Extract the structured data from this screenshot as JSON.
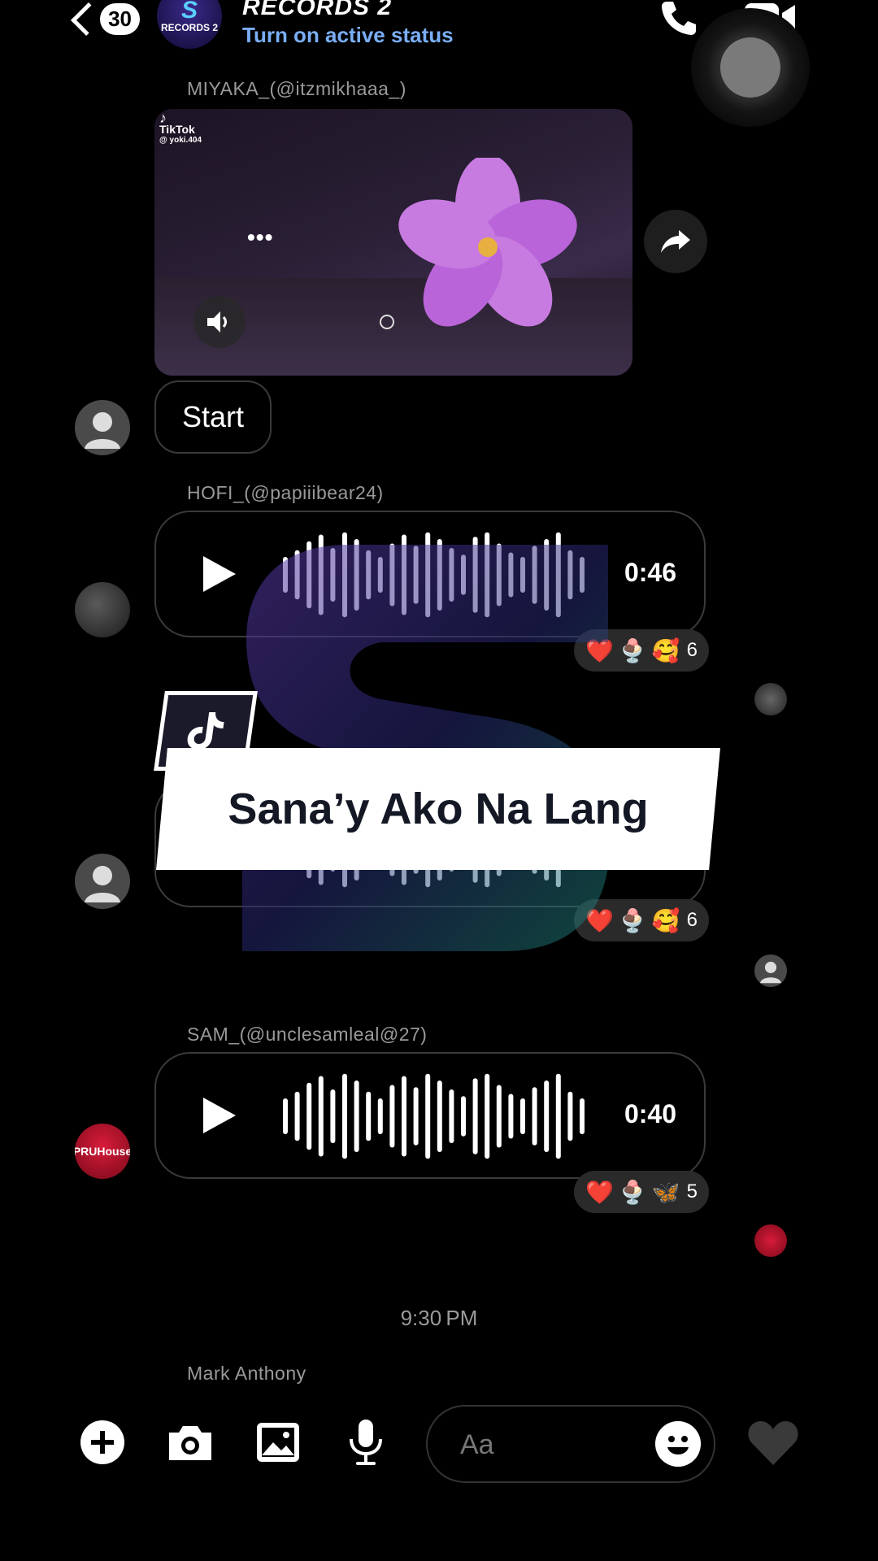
{
  "header": {
    "unread_count": "30",
    "group_avatar_text": "RECORDS 2",
    "group_avatar_letter": "S",
    "title": "RECORDS 2",
    "status": "Turn on active status"
  },
  "messages": [
    {
      "sender": "MIYAKA_(@itzmikhaaa_)",
      "type": "video",
      "watermark_brand": "TikTok",
      "watermark_user": "@ yoki.404",
      "menu_dots": "•••",
      "reply_button": "Start"
    },
    {
      "sender": "HOFI_(@papiiibear24)",
      "type": "voice",
      "duration": "0:46",
      "reactions": [
        "❤️",
        "🍨",
        "🥰"
      ],
      "reaction_count": "6"
    },
    {
      "type": "voice",
      "reactions": [
        "❤️",
        "🍨",
        "🥰"
      ],
      "reaction_count": "6"
    },
    {
      "sender": "SAM_(@unclesamleal@27)",
      "type": "voice",
      "duration": "0:40",
      "reactions": [
        "❤️",
        "🍨",
        "🦋"
      ],
      "reaction_count": "5"
    }
  ],
  "overlay": {
    "song_title": "Sana’y Ako Na Lang"
  },
  "avatar_logo_text": "PRUHouse",
  "timestamp": "9:30 PM",
  "next_sender": "Mark Anthony",
  "composer": {
    "placeholder": "Aa"
  },
  "icons": {
    "back": "chevron-left-icon",
    "call": "phone-icon",
    "video": "video-camera-icon",
    "share": "share-icon",
    "sound": "speaker-icon",
    "plus": "plus-circle-icon",
    "camera": "camera-icon",
    "gallery": "image-icon",
    "mic": "microphone-icon",
    "emoji": "smiley-icon",
    "like": "heart-icon"
  },
  "colors": {
    "background": "#000000",
    "status_blue": "#7aaef5",
    "bubble_border": "#3a3a3a",
    "reaction_bg": "#2a2a2a"
  }
}
